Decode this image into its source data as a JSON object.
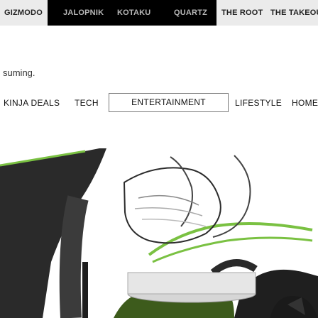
{
  "network_bar": {
    "tabs": [
      {
        "label": "GIZMODO",
        "light": true
      },
      {
        "label": "JALOPNIK",
        "light": false
      },
      {
        "label": "KOTAKU",
        "light": false
      },
      {
        "label": "QUARTZ",
        "light": false
      },
      {
        "label": "THE ROOT",
        "light": true
      },
      {
        "label": "THE TAKEOU",
        "light": true
      }
    ]
  },
  "snippet_text": "suming.",
  "category_nav": {
    "items": [
      {
        "label": "KINJA DEALS",
        "active": false
      },
      {
        "label": "TECH",
        "active": false
      },
      {
        "label": "ENTERTAINMENT",
        "active": true
      },
      {
        "label": "LIFESTYLE",
        "active": false
      },
      {
        "label": "HOME G",
        "active": false
      }
    ]
  },
  "hero": {
    "icon": "product-image",
    "colors": {
      "accent": "#7ac142",
      "dark": "#2b2b2b"
    }
  }
}
